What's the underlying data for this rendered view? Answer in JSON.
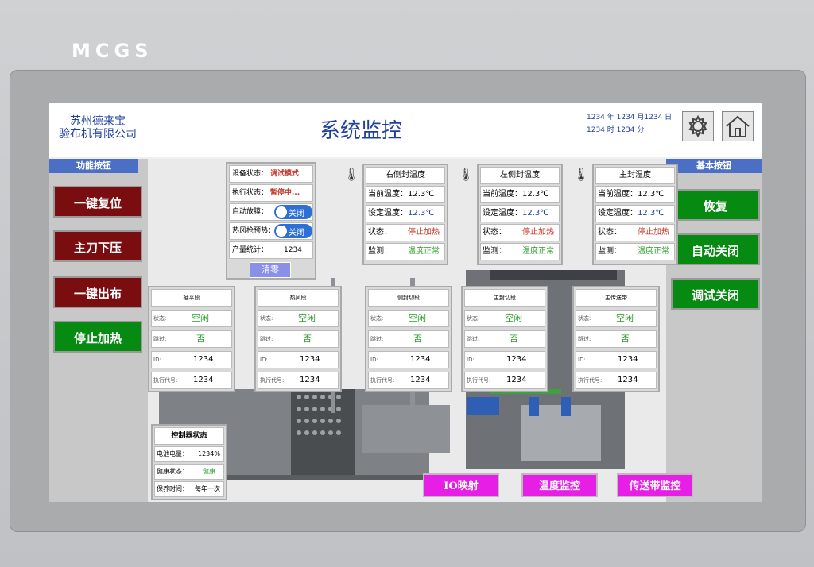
{
  "brand": "MCGS",
  "header": {
    "company_line1": "苏州德来宝",
    "company_line2": "验布机有限公司",
    "title": "系统监控",
    "datetime_line1": "1234 年 1234 月1234 日",
    "datetime_line2": "1234 时 1234 分"
  },
  "left_sidebar": {
    "title": "功能按钮",
    "buttons": [
      "一键复位",
      "主刀下压",
      "一键出布",
      "停止加热"
    ]
  },
  "right_sidebar": {
    "title": "基本按钮",
    "buttons": [
      "恢复",
      "自动关闭",
      "调试关闭"
    ]
  },
  "status_panel": {
    "device_status_label": "设备状态：",
    "device_status_value": "调试模式",
    "exec_status_label": "执行状态：",
    "exec_status_value": "暂停中...",
    "auto_film_label": "自动放膜：",
    "auto_film_toggle": "关闭",
    "hot_air_label": "热风枪预热：",
    "hot_air_toggle": "关闭",
    "output_label": "产量统计：",
    "output_value": "1234",
    "clear_button": "清零"
  },
  "temp_panels": [
    {
      "title": "右侧封温度",
      "current_label": "当前温度：",
      "current": "12.3℃",
      "set_label": "设定温度：",
      "set": "12.3℃",
      "state_label": "状态：",
      "state": "停止加热",
      "monitor_label": "监测：",
      "monitor": "温度正常"
    },
    {
      "title": "左侧封温度",
      "current_label": "当前温度：",
      "current": "12.3℃",
      "set_label": "设定温度：",
      "set": "12.3℃",
      "state_label": "状态：",
      "state": "停止加热",
      "monitor_label": "监测：",
      "monitor": "温度正常"
    },
    {
      "title": "主封温度",
      "current_label": "当前温度：",
      "current": "12.3℃",
      "set_label": "设定温度：",
      "set": "12.3℃",
      "state_label": "状态：",
      "state": "停止加热",
      "monitor_label": "监测：",
      "monitor": "温度正常"
    }
  ],
  "stations": [
    {
      "title": "抽平段",
      "state_label": "状态:",
      "state": "空闲",
      "skip_label": "跳过:",
      "skip": "否",
      "id_label": "ID:",
      "id": "1234",
      "code_label": "执行代号:",
      "code": "1234"
    },
    {
      "title": "热风段",
      "state_label": "状态:",
      "state": "空闲",
      "skip_label": "跳过:",
      "skip": "否",
      "id_label": "ID:",
      "id": "1234",
      "code_label": "执行代号:",
      "code": "1234"
    },
    {
      "title": "侧封切段",
      "state_label": "状态:",
      "state": "空闲",
      "skip_label": "跳过:",
      "skip": "否",
      "id_label": "ID:",
      "id": "1234",
      "code_label": "执行代号:",
      "code": "1234"
    },
    {
      "title": "主封切段",
      "state_label": "状态:",
      "state": "空闲",
      "skip_label": "跳过:",
      "skip": "否",
      "id_label": "ID:",
      "id": "1234",
      "code_label": "执行代号:",
      "code": "1234"
    },
    {
      "title": "主传送带",
      "state_label": "状态:",
      "state": "空闲",
      "skip_label": "跳过:",
      "skip": "否",
      "id_label": "ID:",
      "id": "1234",
      "code_label": "执行代号:",
      "code": "1234"
    }
  ],
  "controller": {
    "title": "控制器状态",
    "battery_label": "电池电量：",
    "battery": "1234%",
    "health_label": "健康状态：",
    "health": "健康",
    "maint_label": "保养时间：",
    "maint": "每年一次"
  },
  "bottom_buttons": [
    "IO映射",
    "温度监控",
    "传送带监控"
  ],
  "icons": {
    "settings": "gear-icon",
    "home": "home-icon",
    "temperature": "thermometer-icon"
  },
  "colors": {
    "title_blue": "#1f3fa0",
    "button_red": "#7a0d10",
    "button_green": "#078a12",
    "nav_pink": "#e61ee6",
    "sidebar_header": "#4a6fc4"
  }
}
